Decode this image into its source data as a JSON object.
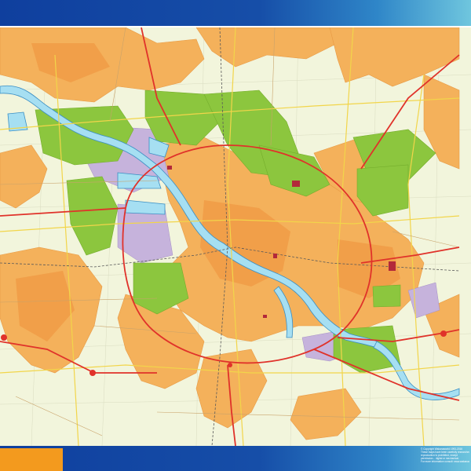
{
  "map": {
    "colors": {
      "background": "#f2f5dc",
      "urban": "#f4b15b",
      "urban_dark": "#ee8f3a",
      "park": "#8cc63e",
      "industrial": "#c6b3dc",
      "water": "#a6dff2",
      "water_edge": "#3b8fc4",
      "major_road": "#e0322a",
      "secondary_road": "#f2d54a",
      "minor_road": "#c9a36b",
      "rail": "#5a5a5a",
      "frame_blue": "#164ea8",
      "title_tab": "#f39a1e"
    }
  },
  "copyright": {
    "lines": [
      "© Copyright Wakanaworld 1993-2016",
      "These maps have been carefully researched but",
      "reproduction is prohibited, except",
      "permission... digital or mechanical.",
      "For more information consult: www.wakanaworld.com"
    ]
  }
}
